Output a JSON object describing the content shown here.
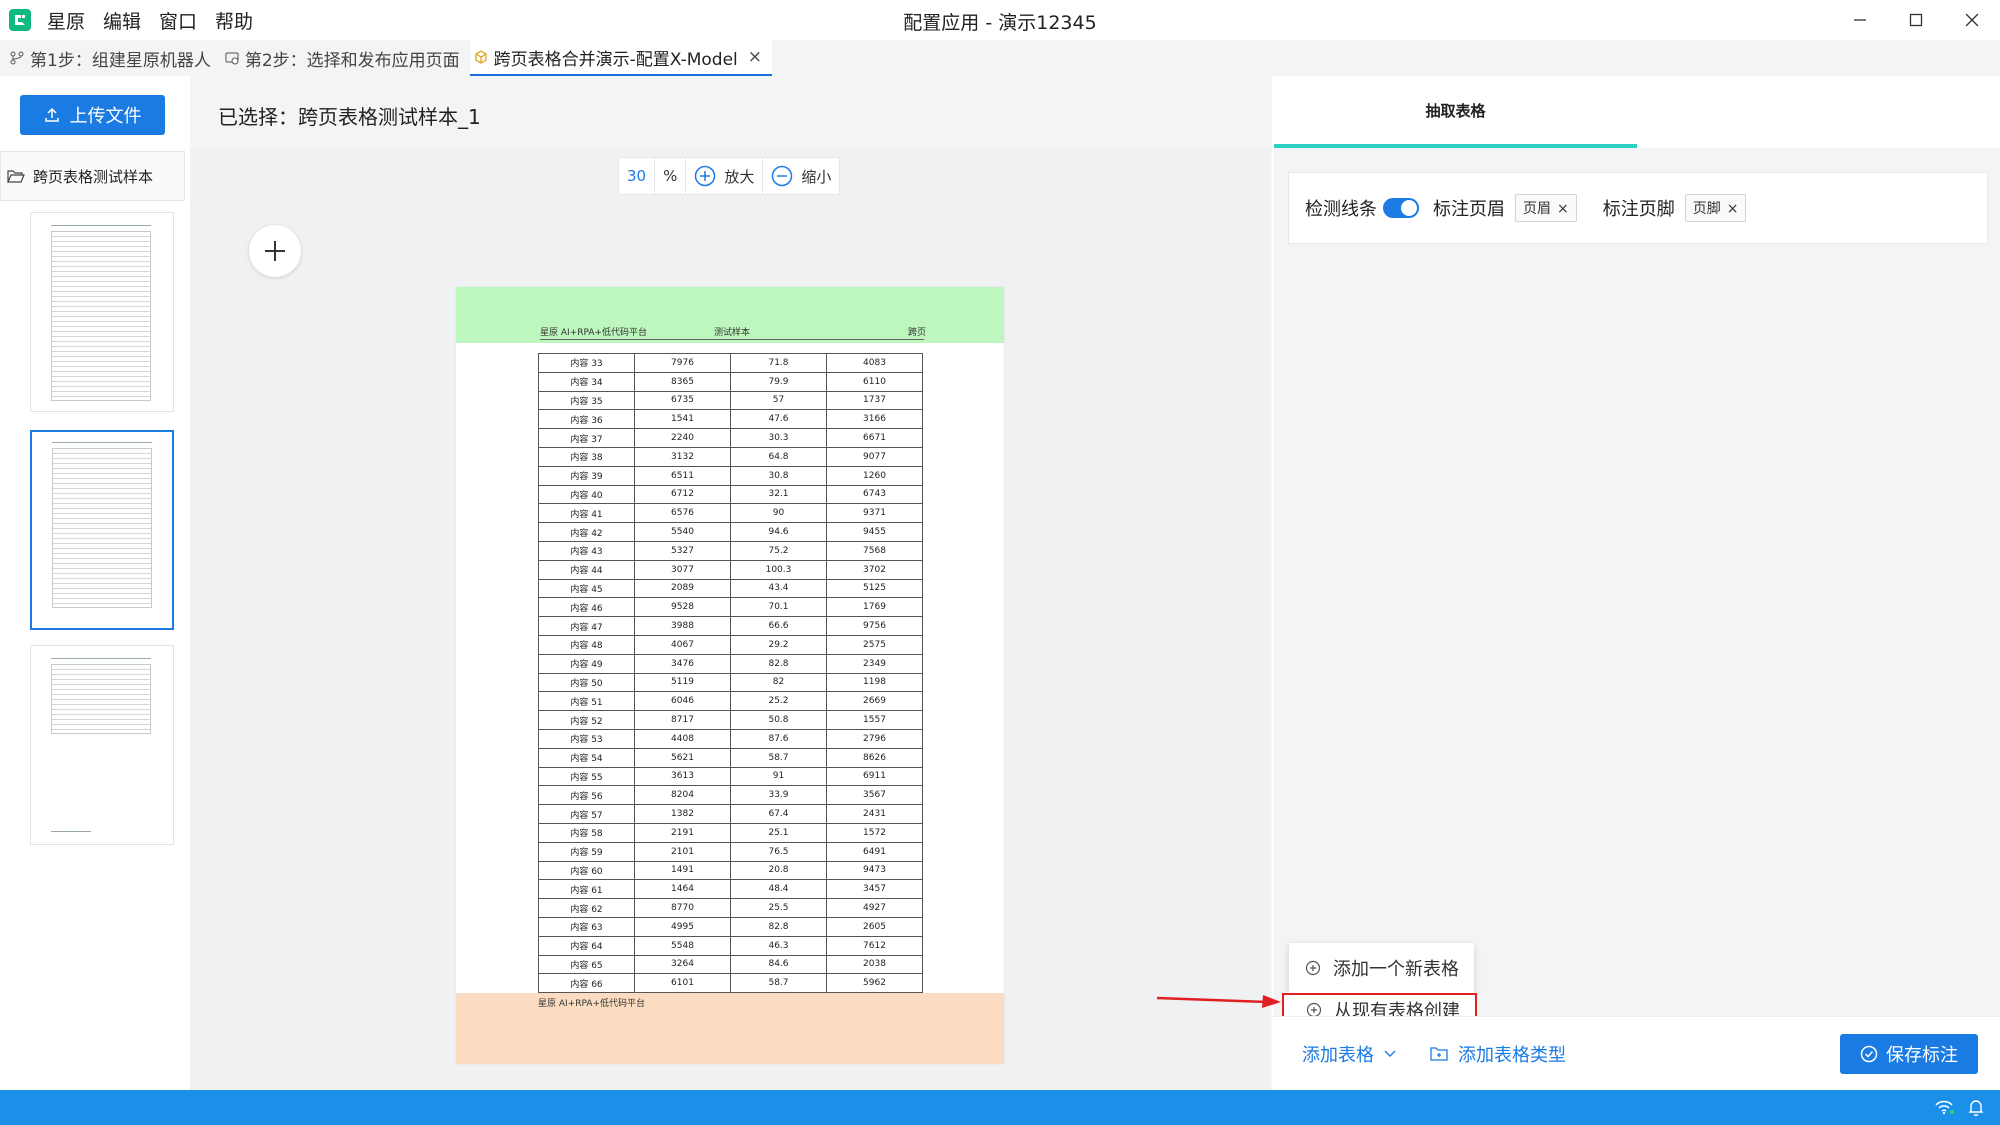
{
  "window": {
    "title": "配置应用 - 演示12345",
    "menu": [
      "星原",
      "编辑",
      "窗口",
      "帮助"
    ]
  },
  "tabs": [
    {
      "label": "第1步：组建星原机器人",
      "icon": "branch-icon"
    },
    {
      "label": "第2步：选择和发布应用页面",
      "icon": "publish-icon"
    },
    {
      "label": "跨页表格合并演示-配置X-Model",
      "icon": "cube-icon",
      "close": "×"
    }
  ],
  "sidebar": {
    "upload_label": "上传文件",
    "file_name": "跨页表格测试样本"
  },
  "header": {
    "selected": "已选择：跨页表格测试样本_1"
  },
  "zoom": {
    "value": "30",
    "unit": "%",
    "zoom_in": "放大",
    "zoom_out": "缩小"
  },
  "page": {
    "header_left": "星原 AI+RPA+低代码平台",
    "header_center": "测试样本",
    "header_right": "跨页",
    "footer_left": "星原 AI+RPA+低代码平台",
    "rows": [
      [
        "内容 33",
        "7976",
        "71.8",
        "4083"
      ],
      [
        "内容 34",
        "8365",
        "79.9",
        "6110"
      ],
      [
        "内容 35",
        "6735",
        "57",
        "1737"
      ],
      [
        "内容 36",
        "1541",
        "47.6",
        "3166"
      ],
      [
        "内容 37",
        "2240",
        "30.3",
        "6671"
      ],
      [
        "内容 38",
        "3132",
        "64.8",
        "9077"
      ],
      [
        "内容 39",
        "6511",
        "30.8",
        "1260"
      ],
      [
        "内容 40",
        "6712",
        "32.1",
        "6743"
      ],
      [
        "内容 41",
        "6576",
        "90",
        "9371"
      ],
      [
        "内容 42",
        "5540",
        "94.6",
        "9455"
      ],
      [
        "内容 43",
        "5327",
        "75.2",
        "7568"
      ],
      [
        "内容 44",
        "3077",
        "100.3",
        "3702"
      ],
      [
        "内容 45",
        "2089",
        "43.4",
        "5125"
      ],
      [
        "内容 46",
        "9528",
        "70.1",
        "1769"
      ],
      [
        "内容 47",
        "3988",
        "66.6",
        "9756"
      ],
      [
        "内容 48",
        "4067",
        "29.2",
        "2575"
      ],
      [
        "内容 49",
        "3476",
        "82.8",
        "2349"
      ],
      [
        "内容 50",
        "5119",
        "82",
        "1198"
      ],
      [
        "内容 51",
        "6046",
        "25.2",
        "2669"
      ],
      [
        "内容 52",
        "8717",
        "50.8",
        "1557"
      ],
      [
        "内容 53",
        "4408",
        "87.6",
        "2796"
      ],
      [
        "内容 54",
        "5621",
        "58.7",
        "8626"
      ],
      [
        "内容 55",
        "3613",
        "91",
        "6911"
      ],
      [
        "内容 56",
        "8204",
        "33.9",
        "3567"
      ],
      [
        "内容 57",
        "1382",
        "67.4",
        "2431"
      ],
      [
        "内容 58",
        "2191",
        "25.1",
        "1572"
      ],
      [
        "内容 59",
        "2101",
        "76.5",
        "6491"
      ],
      [
        "内容 60",
        "1491",
        "20.8",
        "9473"
      ],
      [
        "内容 61",
        "1464",
        "48.4",
        "3457"
      ],
      [
        "内容 62",
        "8770",
        "25.5",
        "4927"
      ],
      [
        "内容 63",
        "4995",
        "82.8",
        "2605"
      ],
      [
        "内容 64",
        "5548",
        "46.3",
        "7612"
      ],
      [
        "内容 65",
        "3264",
        "84.6",
        "2038"
      ],
      [
        "内容 66",
        "6101",
        "58.7",
        "5962"
      ]
    ]
  },
  "right_panel": {
    "tab_label": "抽取表格",
    "detect_lines": "检测线条",
    "mark_header": "标注页眉",
    "header_tag": "页眉",
    "mark_footer": "标注页脚",
    "footer_tag": "页脚",
    "tag_close": "×"
  },
  "dropdown": {
    "add_new": "添加一个新表格",
    "create_from_existing": "从现有表格创建"
  },
  "bottom": {
    "add_table": "添加表格",
    "add_table_type": "添加表格类型",
    "save": "保存标注"
  },
  "colors": {
    "primary": "#1a7be3",
    "header_band": "#bdf7bd",
    "footer_band": "#fbdcc0",
    "highlight": "#e02020",
    "tab_indicator": "#2bd0c0",
    "statusbar": "#1a90e8"
  }
}
